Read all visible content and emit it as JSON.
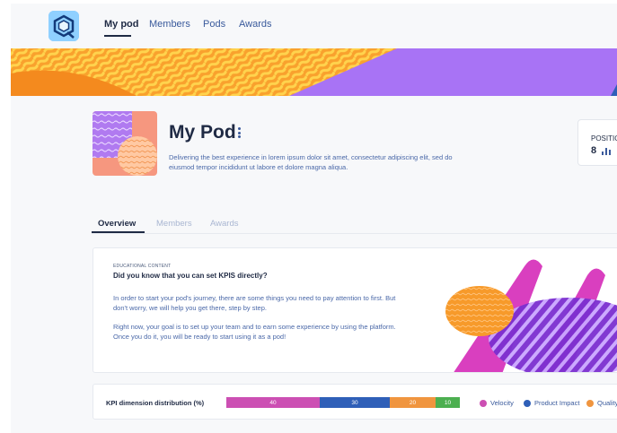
{
  "nav": {
    "items": [
      {
        "label": "My pod",
        "active": true
      },
      {
        "label": "Members",
        "active": false
      },
      {
        "label": "Pods",
        "active": false
      },
      {
        "label": "Awards",
        "active": false
      }
    ]
  },
  "pod": {
    "title": "My Pod",
    "description": "Delivering the best experience  in lorem ipsum dolor sit amet, consectetur adipiscing elit, sed do eiusmod tempor incididunt ut labore et dolore magna aliqua."
  },
  "position": {
    "label": "POSITIC",
    "value": "8"
  },
  "tabs": [
    {
      "label": "Overview",
      "active": true
    },
    {
      "label": "Members",
      "active": false
    },
    {
      "label": "Awards",
      "active": false
    }
  ],
  "edu": {
    "kicker": "EDUCATIONAL CONTENT",
    "title": "Did you know that you can set KPIS directly?",
    "paragraph1": "In order to start your pod's journey, there are some things you need to pay attention to first. But don't worry, we will help you get there, step by step.",
    "paragraph2": "Right now, your goal is to set up your team and to earn some experience by using the platform. Once you do it, you will be ready to start using it as a pod!"
  },
  "kpi": {
    "label": "KPI dimension distribution (%)",
    "segments": [
      {
        "value": "40",
        "color": "#cc4fb3"
      },
      {
        "value": "30",
        "color": "#2f5fb8"
      },
      {
        "value": "20",
        "color": "#f0953f"
      },
      {
        "value": "10",
        "color": "#4caf50"
      }
    ],
    "legend": [
      {
        "label": "Velocity",
        "color": "#cc4fb3"
      },
      {
        "label": "Product Impact",
        "color": "#2f5fb8"
      },
      {
        "label": "Quality",
        "color": "#f0953f"
      }
    ]
  },
  "colors": {
    "accent_dark": "#1f2a44",
    "link_blue": "#3a5a9c",
    "banner_orange": "#f79a2a",
    "banner_yellow": "#ffd34d",
    "banner_purple": "#a873f5"
  }
}
